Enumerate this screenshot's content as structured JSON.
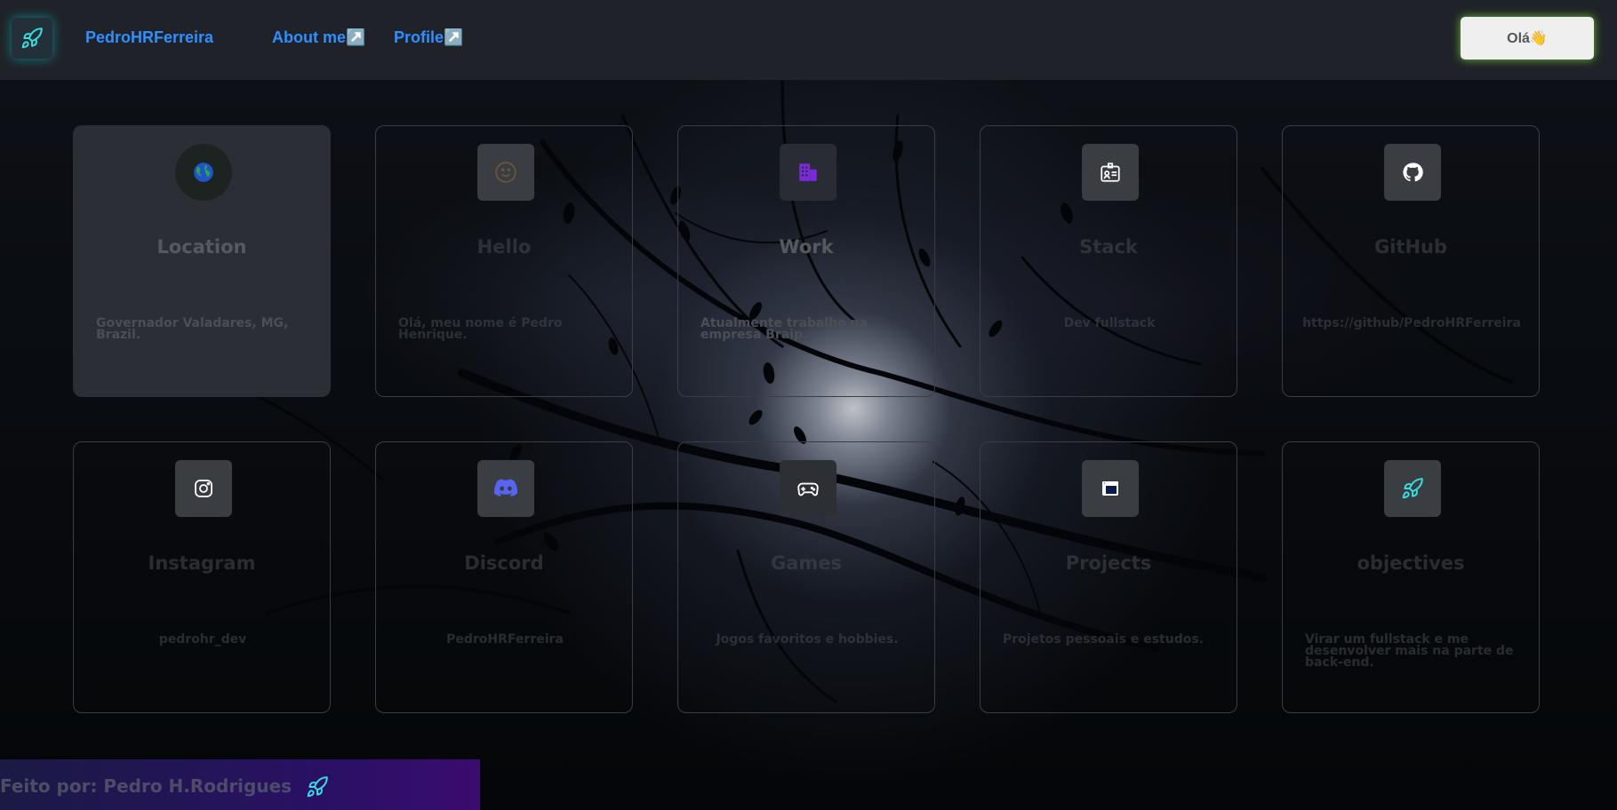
{
  "header": {
    "brand": "PedroHRFerreira",
    "nav": [
      {
        "label": "About me↗️"
      },
      {
        "label": "Profile↗️"
      }
    ],
    "hello_button": "Olá👋"
  },
  "cards": [
    {
      "title": "Location",
      "text": "Governador Valadares, MG, Brazil.",
      "icon": "globe-icon"
    },
    {
      "title": "Hello",
      "text": "Olá, meu nome é Pedro Henrique.",
      "icon": "smiley-icon"
    },
    {
      "title": "Work",
      "text": "Atualmente trabalho na empresa Braip.",
      "icon": "building-icon"
    },
    {
      "title": "Stack",
      "text": "Dev fullstack",
      "icon": "id-badge-icon"
    },
    {
      "title": "GitHub",
      "text": "https://github/PedroHRFerreira",
      "icon": "github-icon"
    },
    {
      "title": "Instagram",
      "text": "pedrohr_dev",
      "icon": "instagram-icon"
    },
    {
      "title": "Discord",
      "text": "PedroHRFerreira",
      "icon": "discord-icon"
    },
    {
      "title": "Games",
      "text": "Jogos favoritos e hobbies.",
      "icon": "gamepad-icon"
    },
    {
      "title": "Projects",
      "text": "Projetos pessoais e estudos.",
      "icon": "browser-window-icon"
    },
    {
      "title": "objectives",
      "text": "Virar um fullstack e me desenvolver mais na parte de back-end.",
      "icon": "rocket-icon"
    }
  ],
  "footer": {
    "text": "Feito por: Pedro H.Rodrigues"
  },
  "colors": {
    "accent": "#2f8fff",
    "glow_green": "#82dc3c",
    "glow_cyan": "#00d2d2",
    "footer_purple": "#2a1066"
  }
}
